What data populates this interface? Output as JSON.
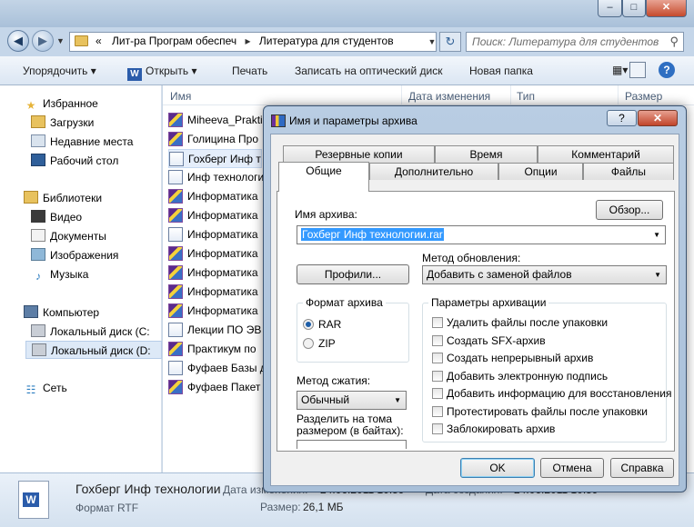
{
  "window": {
    "minimize_glyph": "–",
    "maximize_glyph": "□",
    "close_glyph": "✕"
  },
  "address": {
    "chevrons": "«",
    "crumbs": [
      "Лит-ра Програм обеспеч",
      "Литература для студентов"
    ],
    "separator": "▸",
    "search_placeholder": "Поиск: Литература для студентов"
  },
  "toolbar": {
    "organize": "Упорядочить ▾",
    "open": "Открыть ▾",
    "print": "Печать",
    "burn": "Записать на оптический диск",
    "new_folder": "Новая папка",
    "help": "?"
  },
  "nav": {
    "favorites": "Избранное",
    "downloads": "Загрузки",
    "recent": "Недавние места",
    "desktop": "Рабочий стол",
    "libraries": "Библиотеки",
    "video": "Видео",
    "documents": "Документы",
    "pictures": "Изображения",
    "music": "Музыка",
    "computer": "Компьютер",
    "disk_c": "Локальный диск (C:",
    "disk_d": "Локальный диск (D:",
    "network": "Сеть"
  },
  "columns": {
    "name": "Имя",
    "date": "Дата изменения",
    "type": "Тип",
    "size": "Размер"
  },
  "files": [
    {
      "name": "Miheeva_Prakti",
      "kind": "rar"
    },
    {
      "name": "Голицина Про",
      "kind": "rar"
    },
    {
      "name": "Гохберг Инф т",
      "kind": "doc"
    },
    {
      "name": "Инф технологи",
      "kind": "doc"
    },
    {
      "name": "Информатика",
      "kind": "rar"
    },
    {
      "name": "Информатика",
      "kind": "rar"
    },
    {
      "name": "Информатика",
      "kind": "doc"
    },
    {
      "name": "Информатика",
      "kind": "rar"
    },
    {
      "name": "Информатика",
      "kind": "rar"
    },
    {
      "name": "Информатика",
      "kind": "rar"
    },
    {
      "name": "Информатика",
      "kind": "rar"
    },
    {
      "name": "Лекции ПО ЭВ",
      "kind": "doc"
    },
    {
      "name": "Практикум по",
      "kind": "rar"
    },
    {
      "name": "Фуфаев Базы д",
      "kind": "doc"
    },
    {
      "name": "Фуфаев Пакет",
      "kind": "rar"
    }
  ],
  "status": {
    "file_name": "Гохберг Инф технологии",
    "file_type": "Формат RTF",
    "date_label": "Дата изменения:",
    "date_value": "24.06.2011 10:59",
    "created_label": "Дата создания:",
    "created_value": "24.06.2011 10:59",
    "size_label": "Размер:",
    "size_value": "26,1 МБ"
  },
  "dialog": {
    "title": "Имя и параметры архива",
    "help": "?",
    "close": "✕",
    "tabs_back": [
      "Резервные копии",
      "Время",
      "Комментарий"
    ],
    "tabs_front": [
      "Общие",
      "Дополнительно",
      "Опции",
      "Файлы"
    ],
    "archive_name_label": "Имя архива:",
    "browse": "Обзор...",
    "archive_name_value": "Гохберг Инф технологии.rar",
    "profiles": "Профили...",
    "update_label": "Метод обновления:",
    "update_value": "Добавить с заменой файлов",
    "format_label": "Формат архива",
    "format_rar": "RAR",
    "format_zip": "ZIP",
    "compression_label": "Метод сжатия:",
    "compression_value": "Обычный",
    "split_label_1": "Разделить на тома",
    "split_label_2": "размером (в байтах):",
    "split_value": "",
    "params_label": "Параметры архивации",
    "options": [
      "Удалить файлы после упаковки",
      "Создать SFX-архив",
      "Создать непрерывный архив",
      "Добавить электронную подпись",
      "Добавить информацию для восстановления",
      "Протестировать файлы после упаковки",
      "Заблокировать архив"
    ],
    "ok": "OK",
    "cancel": "Отмена",
    "help_button": "Справка"
  }
}
